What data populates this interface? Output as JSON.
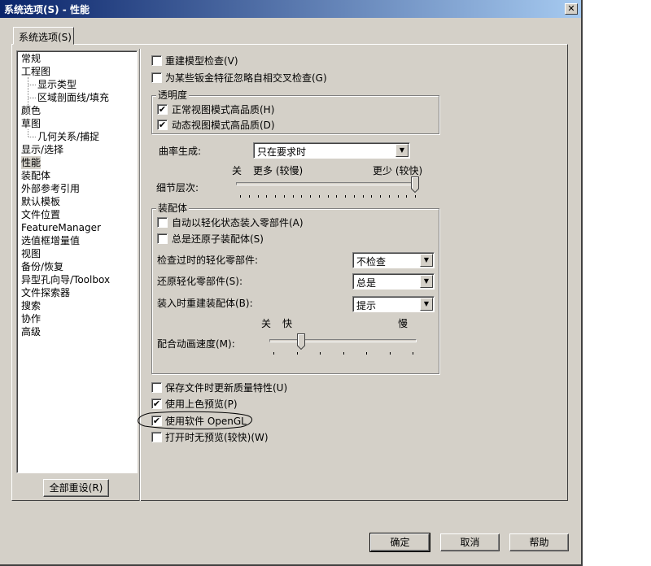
{
  "window": {
    "title": "系统选项(S) - 性能",
    "close_glyph": "✕"
  },
  "tab": {
    "label": "系统选项(S)"
  },
  "sidebar": {
    "items": [
      {
        "label": "常规"
      },
      {
        "label": "工程图"
      },
      {
        "label": "显示类型"
      },
      {
        "label": "区域剖面线/填充"
      },
      {
        "label": "颜色"
      },
      {
        "label": "草图"
      },
      {
        "label": "几何关系/捕捉"
      },
      {
        "label": "显示/选择"
      },
      {
        "label": "性能"
      },
      {
        "label": "装配体"
      },
      {
        "label": "外部参考引用"
      },
      {
        "label": "默认模板"
      },
      {
        "label": "文件位置"
      },
      {
        "label": "FeatureManager"
      },
      {
        "label": "选值框增量值"
      },
      {
        "label": "视图"
      },
      {
        "label": "备份/恢复"
      },
      {
        "label": "异型孔向导/Toolbox"
      },
      {
        "label": "文件探索器"
      },
      {
        "label": "搜索"
      },
      {
        "label": "协作"
      },
      {
        "label": "高级"
      }
    ],
    "selected": "性能",
    "reset_label": "全部重设(R)"
  },
  "options": {
    "rebuild_check": {
      "label": "重建模型检查(V)",
      "checked": false
    },
    "sheetmetal_check": {
      "label": "为某些钣金特征忽略自相交叉检查(G)",
      "checked": false
    },
    "transparency": {
      "title": "透明度",
      "normal": {
        "label": "正常视图模式高品质(H)",
        "checked": true
      },
      "dynamic": {
        "label": "动态视图模式高品质(D)",
        "checked": true
      }
    },
    "curvature": {
      "label": "曲率生成:",
      "value": "只在要求时"
    },
    "detail": {
      "label": "细节层次:",
      "off": "关",
      "more": "更多 (较慢)",
      "less": "更少 (较快)",
      "level": 1.0
    },
    "assembly": {
      "title": "装配体",
      "auto_lightweight": {
        "label": "自动以轻化状态装入零部件(A)",
        "checked": false
      },
      "always_resolve": {
        "label": "总是还原子装配体(S)",
        "checked": false
      },
      "check_outdated": {
        "label": "检查过时的轻化零部件:",
        "value": "不检查"
      },
      "resolve_lightweight": {
        "label": "还原轻化零部件(S):",
        "value": "总是"
      },
      "rebuild_on_load": {
        "label": "装入时重建装配体(B):",
        "value": "提示"
      },
      "animation": {
        "label": "配合动画速度(M):",
        "off": "关",
        "fast": "快",
        "slow": "慢",
        "level": 0.2
      }
    },
    "update_mass": {
      "label": "保存文件时更新质量特性(U)",
      "checked": false
    },
    "shaded_preview": {
      "label": "使用上色预览(P)",
      "checked": true
    },
    "software_opengl": {
      "label": "使用软件 OpenGL",
      "checked": true
    },
    "no_preview": {
      "label": "打开时无预览(较快)(W)",
      "checked": false
    }
  },
  "footer": {
    "ok": "确定",
    "cancel": "取消",
    "help": "帮助"
  }
}
